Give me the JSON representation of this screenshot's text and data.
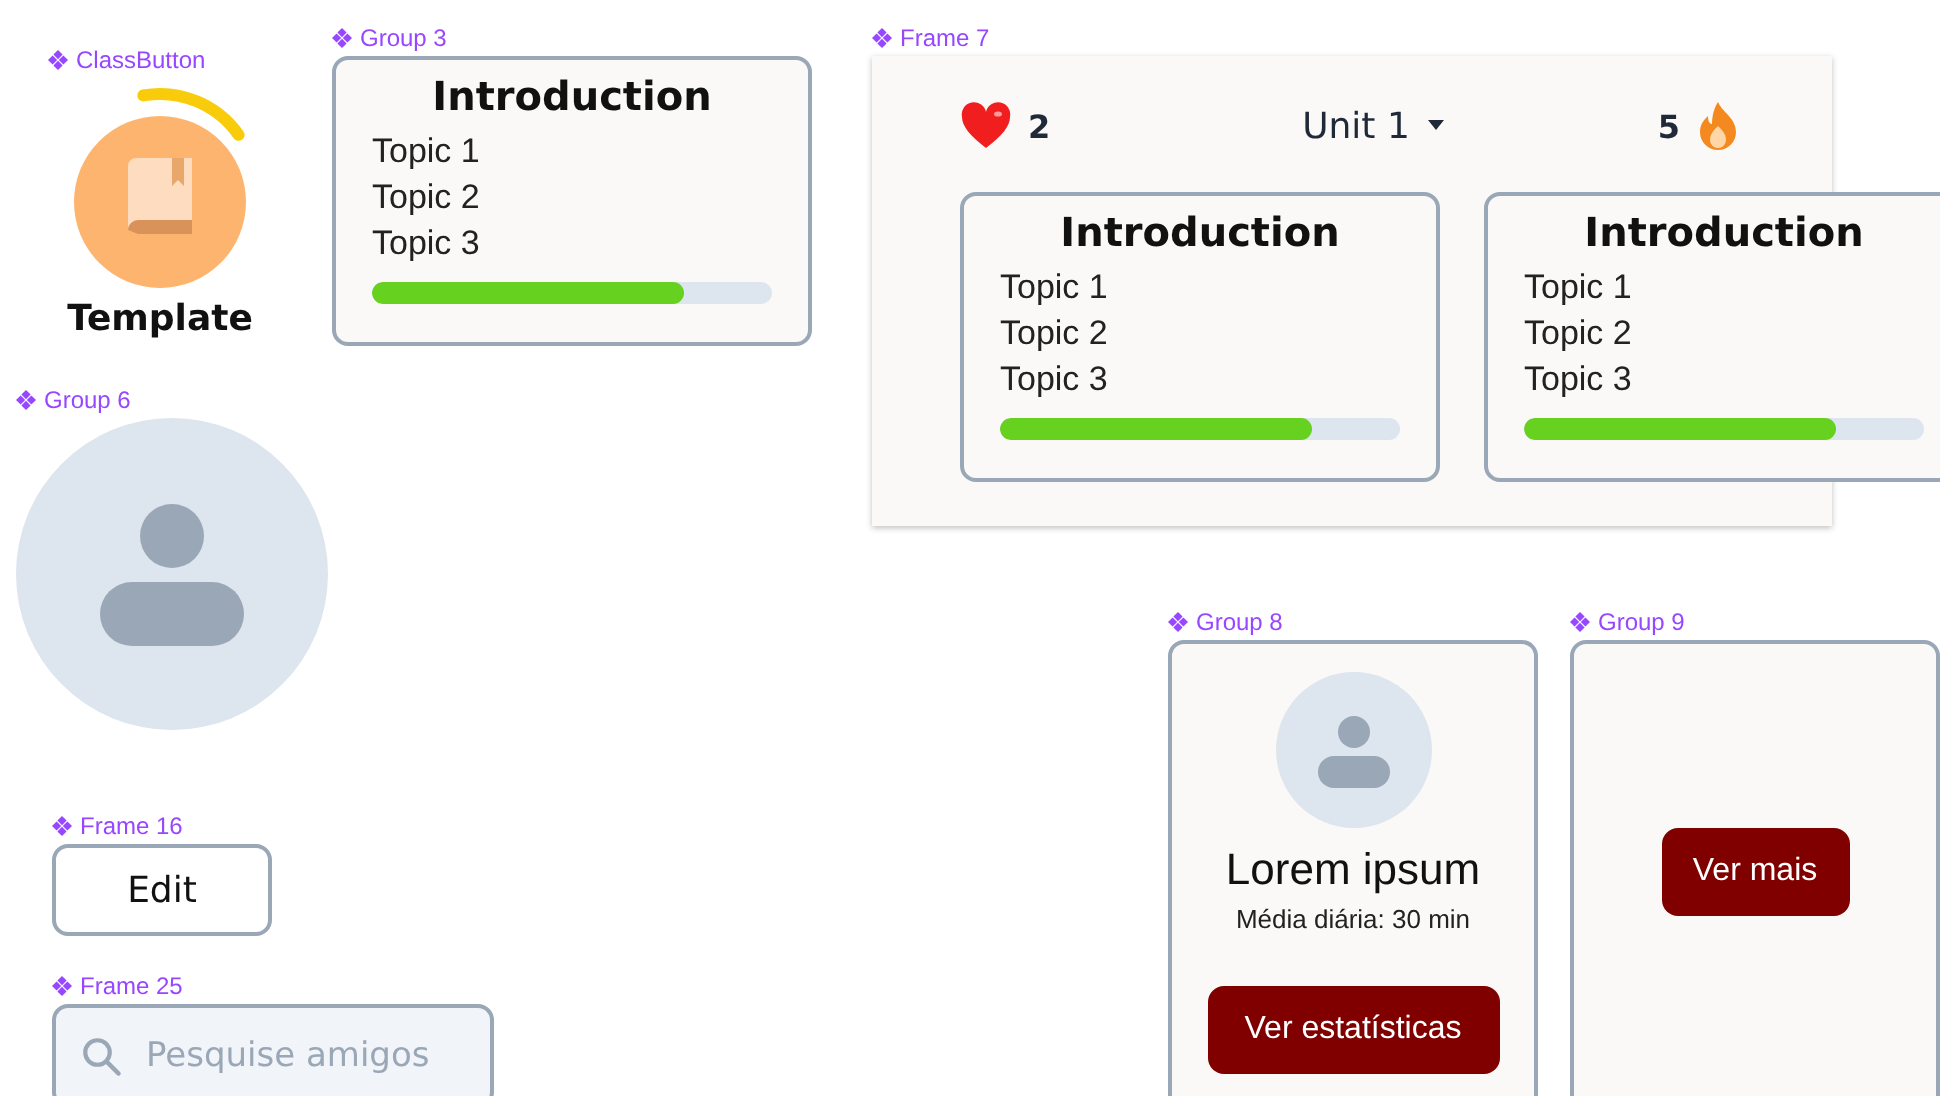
{
  "frames": [
    {
      "kind": "class_button",
      "label": "ClassButton",
      "title": "Template",
      "level": 0.18
    },
    {
      "kind": "topic_card",
      "label": "Group 3",
      "title": "Introduction",
      "topics": [
        "Topic 1",
        "Topic 2",
        "Topic 3"
      ],
      "level": 0.78
    },
    {
      "kind": "avatar",
      "label": "Group 6"
    },
    {
      "kind": "unit_frame",
      "label": "Frame 7",
      "lives": "2",
      "unit": "Unit 1",
      "streak": "5",
      "cards": [
        {
          "title": "Introduction",
          "topics": [
            "Topic 1",
            "Topic 2",
            "Topic 3"
          ],
          "level": 0.78
        },
        {
          "title": "Introduction",
          "topics": [
            "Topic 1",
            "Topic 2",
            "Topic 3"
          ],
          "level": 0.78
        }
      ]
    },
    {
      "kind": "button",
      "label": "Frame 16",
      "text": "Edit"
    },
    {
      "kind": "search",
      "label": "Frame 25",
      "placeholder": "Pesquise amigos"
    },
    {
      "kind": "friend_card",
      "label": "Group 8",
      "name": "Lorem ipsum",
      "detail": "Média diária: 30 min",
      "button": "Ver estatísticas"
    },
    {
      "kind": "more_card",
      "label": "Group 9",
      "button": "Ver mais"
    }
  ]
}
